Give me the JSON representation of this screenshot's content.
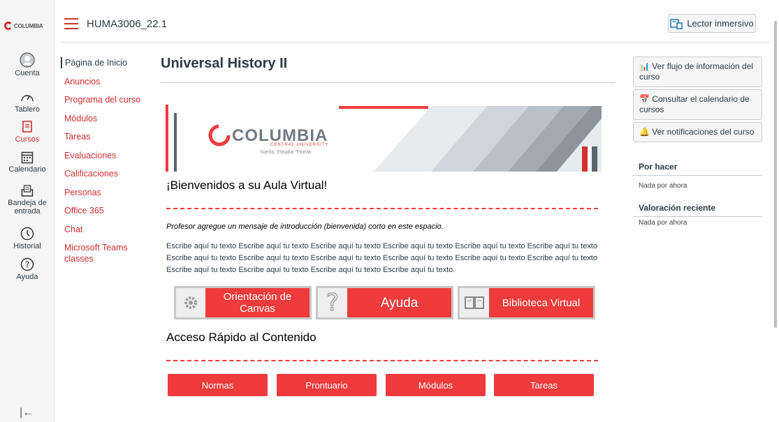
{
  "global_nav": {
    "logo_text": "COLUMBIA",
    "items": [
      {
        "label": "Cuenta",
        "icon": "user-icon"
      },
      {
        "label": "Tablero",
        "icon": "dashboard-icon"
      },
      {
        "label": "Cursos",
        "icon": "book-icon"
      },
      {
        "label": "Calendario",
        "icon": "calendar-icon"
      },
      {
        "label": "Bandeja de entrada",
        "icon": "inbox-icon"
      },
      {
        "label": "Historial",
        "icon": "clock-icon"
      },
      {
        "label": "Ayuda",
        "icon": "help-icon"
      }
    ],
    "collapse_icon": "collapse-icon"
  },
  "header": {
    "breadcrumb": "HUMA3006_22.1",
    "immersive_label": "Lector inmersivo"
  },
  "course_nav": [
    "Página de Inicio",
    "Anuncios",
    "Programa del curso",
    "Módulos",
    "Tareas",
    "Evaluaciones",
    "Calificaciones",
    "Personas",
    "Office 365",
    "Chat",
    "Microsoft Teams classes"
  ],
  "main": {
    "title": "Universal History II",
    "banner": {
      "brand": "COLUMBIA",
      "sub": "CENTRAL UNIVERSITY",
      "tagline": "Sueña. Estudia. Triunfa."
    },
    "welcome": "¡Bienvenidos a su Aula Virtual!",
    "intro": "Profesor agregue un mensaje de introducción (bienvenida) corto en este espacio.",
    "paragraph": "Escribe aquí tu texto Escribe aquí tu texto Escribe aquí tu texto Escribe aquí tu texto Escribe aquí tu texto Escribe aquí tu texto Escribe aquí tu texto Escribe aquí tu texto Escribe aquí tu texto Escribe aquí tu texto Escribe aquí tu texto Escribe aquí tu texto Escribe aquí tu texto Escribe aquí tu texto Escribe aquí tu texto Escribe aquí tu texto.",
    "tiles": [
      {
        "label": "Orientación de Canvas",
        "icon": "gear-icon"
      },
      {
        "label": "Ayuda",
        "icon": "question-icon"
      },
      {
        "label": "Biblioteca Virtual",
        "icon": "book-open-icon"
      }
    ],
    "quick_title": "Acceso Rápido al Contenido",
    "quick_buttons": [
      "Normas",
      "Prontuario",
      "Módulos",
      "Tareas"
    ]
  },
  "sidebar": {
    "buttons": [
      "Ver flujo de información del curso",
      "Consultar el calendario de cursos",
      "Ver notificaciones del curso"
    ],
    "todo_heading": "Por hacer",
    "todo_empty": "Nada por ahora",
    "feedback_heading": "Valoración reciente",
    "feedback_empty": "Nada por ahora"
  },
  "colors": {
    "accent": "#ef3b3b",
    "brand_red": "#d32f2f",
    "text": "#2d3b45"
  }
}
